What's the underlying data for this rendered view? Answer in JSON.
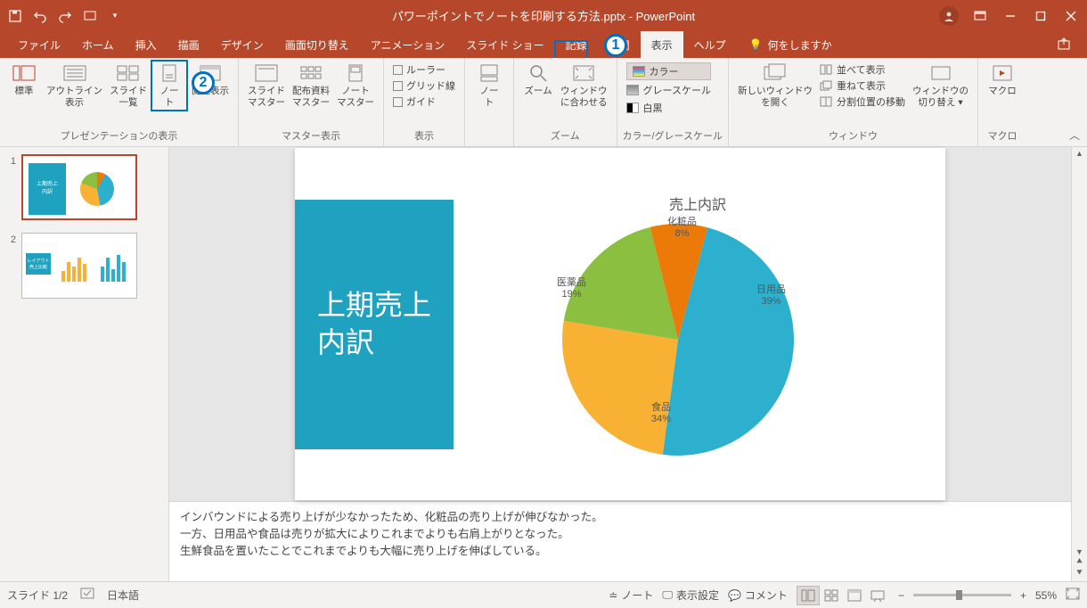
{
  "titlebar": {
    "filename": "パワーポイントでノートを印刷する方法.pptx",
    "app": "PowerPoint"
  },
  "tabs": {
    "file": "ファイル",
    "home": "ホーム",
    "insert": "挿入",
    "draw": "描画",
    "design": "デザイン",
    "transitions": "画面切り替え",
    "animations": "アニメーション",
    "slideshow": "スライド ショー",
    "record": "記録",
    "review": "校閲",
    "view": "表示",
    "help": "ヘルプ",
    "tell_me": "何をしますか"
  },
  "ribbon": {
    "g1": {
      "normal": "標準",
      "outline": "アウトライン\n表示",
      "sorter": "スライド\n一覧",
      "notes_page": "ノー\nト",
      "reading": "閲覧表示",
      "label": "プレゼンテーションの表示"
    },
    "g2": {
      "slide_master": "スライド\nマスター",
      "handout_master": "配布資料\nマスター",
      "notes_master": "ノート\nマスター",
      "label": "マスター表示"
    },
    "g3": {
      "ruler": "ルーラー",
      "gridlines": "グリッド線",
      "guides": "ガイド",
      "label": "表示"
    },
    "g4": {
      "notes": "ノー\nト"
    },
    "g5": {
      "zoom": "ズーム",
      "fit": "ウィンドウ\nに合わせる",
      "label": "ズーム"
    },
    "g6": {
      "color": "カラー",
      "grayscale": "グレースケール",
      "bw": "白黒",
      "label": "カラー/グレースケール"
    },
    "g7": {
      "new_window": "新しいウィンドウ\nを開く",
      "arrange_all": "並べて表示",
      "cascade": "重ねて表示",
      "move_split": "分割位置の移動",
      "switch": "ウィンドウの\n切り替え ▾",
      "label": "ウィンドウ"
    },
    "g8": {
      "macros": "マクロ",
      "label": "マクロ"
    }
  },
  "annotations": {
    "one": "1",
    "two": "2"
  },
  "thumbs": {
    "s1_num": "1",
    "s1_title": "上期売上\n内訳",
    "s2_num": "2",
    "s2_title": "レイアウト\n売上比較"
  },
  "slide": {
    "left_block": "上期売上\n内訳",
    "chart_title": "売上内訳"
  },
  "chart_data": {
    "type": "pie",
    "title": "売上内訳",
    "series": [
      {
        "name": "化粧品",
        "value": 8,
        "label": "化粧品\n8%",
        "color": "#ec7a08"
      },
      {
        "name": "日用品",
        "value": 39,
        "label": "日用品\n39%",
        "color": "#2db0cd"
      },
      {
        "name": "食品",
        "value": 34,
        "label": "食品\n34%",
        "color": "#f8b133"
      },
      {
        "name": "医薬品",
        "value": 19,
        "label": "医薬品\n19%",
        "color": "#8bbf3f"
      }
    ]
  },
  "notes": {
    "line1": "インバウンドによる売り上げが少なかったため、化粧品の売り上げが伸びなかった。",
    "line2": "一方、日用品や食品は売りが拡大によりこれまでよりも右肩上がりとなった。",
    "line3": "生鮮食品を置いたことでこれまでよりも大幅に売り上げを伸ばしている。"
  },
  "statusbar": {
    "slide_counter": "スライド 1/2",
    "language": "日本語",
    "notes_btn": "ノート",
    "display_settings": "表示設定",
    "comments": "コメント",
    "zoom_pct": "55%"
  }
}
